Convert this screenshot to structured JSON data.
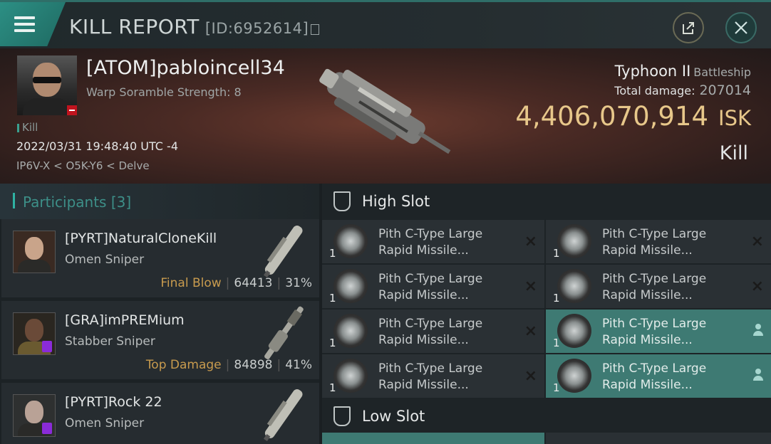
{
  "header": {
    "title": "KILL REPORT",
    "report_id": "[ID:6952614]"
  },
  "victim": {
    "name": "[ATOM]pabloincell34",
    "warp_scramble": "Warp Soramble Strength: 8",
    "kill_tag": "Kill",
    "datetime": "2022/03/31 19:48:40 UTC -4",
    "location": "IP6V-X < O5K-Y6 < Delve",
    "ship_name": "Typhoon II",
    "ship_class": "Battleship",
    "total_damage_label": "Total damage:",
    "total_damage": "207014",
    "isk_value": "4,406,070,914",
    "isk_unit": "ISK",
    "kill_type": "Kill"
  },
  "participants": {
    "header": "Participants [3]",
    "items": [
      {
        "name": "[PYRT]NaturalCloneKill",
        "ship": "Omen Sniper",
        "label": "Final Blow",
        "damage": "64413",
        "percent": "31%"
      },
      {
        "name": "[GRA]imPREMium",
        "ship": "Stabber Sniper",
        "label": "Top Damage",
        "damage": "84898",
        "percent": "41%"
      },
      {
        "name": "[PYRT]Rock 22",
        "ship": "Omen Sniper",
        "label": "",
        "damage": "",
        "percent": ""
      }
    ]
  },
  "slots": {
    "high_label": "High Slot",
    "low_label": "Low Slot",
    "high": [
      {
        "line1": "Pith C-Type Large",
        "line2": "Rapid Missile...",
        "qty": "1",
        "state": "destroyed"
      },
      {
        "line1": "Pith C-Type Large",
        "line2": "Rapid Missile...",
        "qty": "1",
        "state": "destroyed"
      },
      {
        "line1": "Pith C-Type Large",
        "line2": "Rapid Missile...",
        "qty": "1",
        "state": "destroyed"
      },
      {
        "line1": "Pith C-Type Large",
        "line2": "Rapid Missile...",
        "qty": "1",
        "state": "destroyed"
      },
      {
        "line1": "Pith C-Type Large",
        "line2": "Rapid Missile...",
        "qty": "1",
        "state": "destroyed"
      },
      {
        "line1": "Pith C-Type Large",
        "line2": "Rapid Missile...",
        "qty": "1",
        "state": "dropped"
      },
      {
        "line1": "Pith C-Type Large",
        "line2": "Rapid Missile...",
        "qty": "1",
        "state": "destroyed"
      },
      {
        "line1": "Pith C-Type Large",
        "line2": "Rapid Missile...",
        "qty": "1",
        "state": "dropped"
      }
    ]
  },
  "colors": {
    "accent": "#2fb2a3",
    "isk": "#e7c78a",
    "highlight": "#3e7a73",
    "label_gold": "#c89b4e"
  }
}
